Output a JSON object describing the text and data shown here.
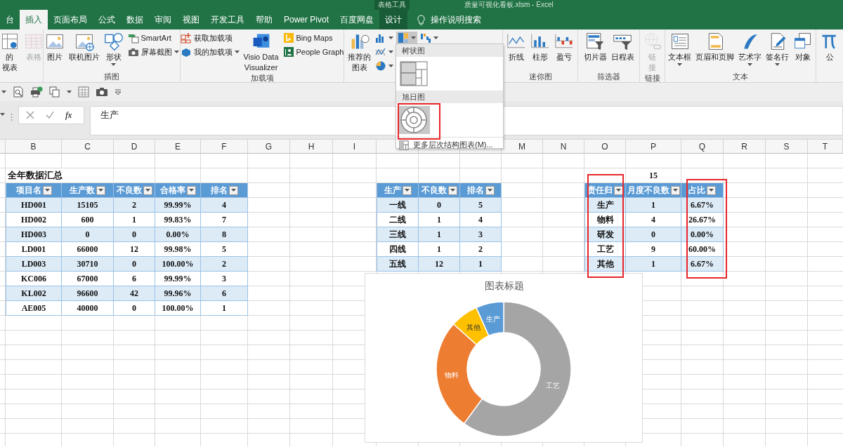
{
  "window": {
    "context_label": "表格工具",
    "title": "质量可视化看板.xlsm - Excel"
  },
  "tabs": [
    {
      "label": "台",
      "kind": "normal",
      "selected": false
    },
    {
      "label": "插入",
      "kind": "normal",
      "selected": true
    },
    {
      "label": "页面布局",
      "kind": "normal",
      "selected": false
    },
    {
      "label": "公式",
      "kind": "normal",
      "selected": false
    },
    {
      "label": "数据",
      "kind": "normal",
      "selected": false
    },
    {
      "label": "审阅",
      "kind": "normal",
      "selected": false
    },
    {
      "label": "视图",
      "kind": "normal",
      "selected": false
    },
    {
      "label": "开发工具",
      "kind": "normal",
      "selected": false
    },
    {
      "label": "帮助",
      "kind": "normal",
      "selected": false
    },
    {
      "label": "Power Pivot",
      "kind": "normal",
      "selected": false
    },
    {
      "label": "百度网盘",
      "kind": "normal",
      "selected": false
    },
    {
      "label": "设计",
      "kind": "contextual",
      "selected": false
    }
  ],
  "tell_me": {
    "placeholder": "操作说明搜索"
  },
  "ribbon": {
    "groups": [
      {
        "items": [
          {
            "kind": "large",
            "lines": [
              "的",
              "视表"
            ],
            "menu": false,
            "disabled": false
          },
          {
            "kind": "large",
            "label": "表格",
            "menu": false,
            "disabled": true
          }
        ]
      },
      {
        "label": "插图",
        "items": [
          {
            "kind": "large",
            "label": "图片",
            "menu": false,
            "disabled": false
          },
          {
            "kind": "large",
            "label": "联机图片",
            "menu": false,
            "disabled": false
          },
          {
            "kind": "large",
            "label": "形状",
            "menu": true,
            "disabled": false
          },
          {
            "kind": "stack",
            "items": [
              {
                "label": "SmartArt",
                "menu": false,
                "disabled": false
              },
              {
                "label": "屏幕截图",
                "menu": true,
                "disabled": false
              }
            ]
          }
        ]
      },
      {
        "label": "加载项",
        "items": [
          {
            "kind": "stack",
            "items": [
              {
                "label": "获取加载项",
                "menu": false,
                "disabled": false
              },
              {
                "label": "我的加载项",
                "menu": true,
                "disabled": false
              }
            ]
          },
          {
            "kind": "large",
            "lines": [
              "Visio Data",
              "Visualizer"
            ],
            "menu": false,
            "disabled": false
          },
          {
            "kind": "stack",
            "items": [
              {
                "label": "Bing Maps",
                "menu": false,
                "disabled": false
              },
              {
                "label": "People Graph",
                "menu": false,
                "disabled": false
              }
            ]
          }
        ]
      },
      {
        "items": [
          {
            "kind": "large",
            "lines": [
              "推荐的",
              "图表"
            ],
            "menu": false,
            "disabled": false
          },
          {
            "kind": "stack",
            "items": [
              {
                "menu": true,
                "disabled": false,
                "pressed": false
              },
              {
                "menu": true,
                "disabled": false,
                "pressed": false
              },
              {
                "menu": true,
                "disabled": false,
                "pressed": false
              }
            ]
          },
          {
            "kind": "stack",
            "items": [
              {
                "menu": true,
                "disabled": false,
                "pressed": true
              }
            ]
          },
          {
            "kind": "stack",
            "items": [
              {
                "menu": true,
                "disabled": false,
                "pressed": false
              }
            ]
          }
        ]
      },
      {
        "label": "迷你图",
        "items": [
          {
            "kind": "large",
            "label": "折线",
            "menu": false,
            "disabled": false
          },
          {
            "kind": "large",
            "label": "柱形",
            "menu": false,
            "disabled": false
          },
          {
            "kind": "large",
            "label": "盈亏",
            "menu": false,
            "disabled": false
          }
        ]
      },
      {
        "label": "筛选器",
        "items": [
          {
            "kind": "large",
            "label": "切片器",
            "menu": false,
            "disabled": false
          },
          {
            "kind": "large",
            "label": "日程表",
            "menu": false,
            "disabled": false
          }
        ]
      },
      {
        "label": "链接",
        "items": [
          {
            "kind": "large",
            "lines": [
              "链",
              "接"
            ],
            "menu": false,
            "disabled": true
          }
        ]
      },
      {
        "label": "文本",
        "items": [
          {
            "kind": "large",
            "label": "文本框",
            "menu": true,
            "disabled": false
          },
          {
            "kind": "large",
            "label": "页眉和页脚",
            "menu": false,
            "disabled": false
          },
          {
            "kind": "large",
            "label": "艺术字",
            "menu": true,
            "disabled": false
          },
          {
            "kind": "large",
            "label": "签名行",
            "menu": true,
            "disabled": false
          },
          {
            "kind": "large",
            "label": "对象",
            "menu": false,
            "disabled": false
          }
        ]
      },
      {
        "items": [
          {
            "kind": "large",
            "label": "公",
            "menu": false,
            "disabled": false
          }
        ]
      }
    ]
  },
  "formula_bar": {
    "function_label": "fx",
    "value": "生产"
  },
  "chart_menu": {
    "sections": [
      {
        "header": "树状图",
        "options": [
          {
            "selected": false
          }
        ]
      },
      {
        "header": "旭日图",
        "options": [
          {
            "selected": true
          }
        ]
      }
    ],
    "more_label": "更多层次结构图表(M)..."
  },
  "sheet": {
    "column_headers": [
      "B",
      "C",
      "D",
      "E",
      "F",
      "G",
      "H",
      "I",
      "M",
      "N",
      "O",
      "P",
      "Q",
      "R",
      "S",
      "T"
    ],
    "title": "全年数据汇总",
    "total": "15",
    "tables": [
      {
        "columns": [
          "项目名",
          "生产数",
          "不良数",
          "合格率",
          "排名"
        ],
        "rows": [
          [
            "HD001",
            "15105",
            "2",
            "99.99%",
            "4"
          ],
          [
            "HD002",
            "600",
            "1",
            "99.83%",
            "7"
          ],
          [
            "HD003",
            "0",
            "0",
            "0.00%",
            "8"
          ],
          [
            "LD001",
            "66000",
            "12",
            "99.98%",
            "5"
          ],
          [
            "LD003",
            "30710",
            "0",
            "100.00%",
            "2"
          ],
          [
            "KC006",
            "67000",
            "6",
            "99.99%",
            "3"
          ],
          [
            "KL002",
            "96600",
            "42",
            "99.96%",
            "6"
          ],
          [
            "AE005",
            "40000",
            "0",
            "100.00%",
            "1"
          ]
        ]
      },
      {
        "columns": [
          "生产",
          "不良数",
          "排名"
        ],
        "rows": [
          [
            "一线",
            "0",
            "5"
          ],
          [
            "二线",
            "1",
            "4"
          ],
          [
            "三线",
            "1",
            "3"
          ],
          [
            "四线",
            "1",
            "2"
          ],
          [
            "五线",
            "12",
            "1"
          ]
        ]
      },
      {
        "columns": [
          "责任归",
          "月度不良数",
          "占比"
        ],
        "rows": [
          [
            "生产",
            "1",
            "6.67%"
          ],
          [
            "物料",
            "4",
            "26.67%"
          ],
          [
            "研发",
            "0",
            "0.00%"
          ],
          [
            "工艺",
            "9",
            "60.00%"
          ],
          [
            "其他",
            "1",
            "6.67%"
          ]
        ]
      }
    ]
  },
  "chart": {
    "chart_data": {
      "type": "donut",
      "title": "图表标题",
      "categories": [
        "工艺",
        "物料",
        "其他",
        "生产"
      ],
      "values": [
        60,
        26.66,
        6.67,
        6.67
      ],
      "colors": [
        "#a5a5a5",
        "#ed7d31",
        "#ffc000",
        "#5b9bd5"
      ]
    }
  }
}
